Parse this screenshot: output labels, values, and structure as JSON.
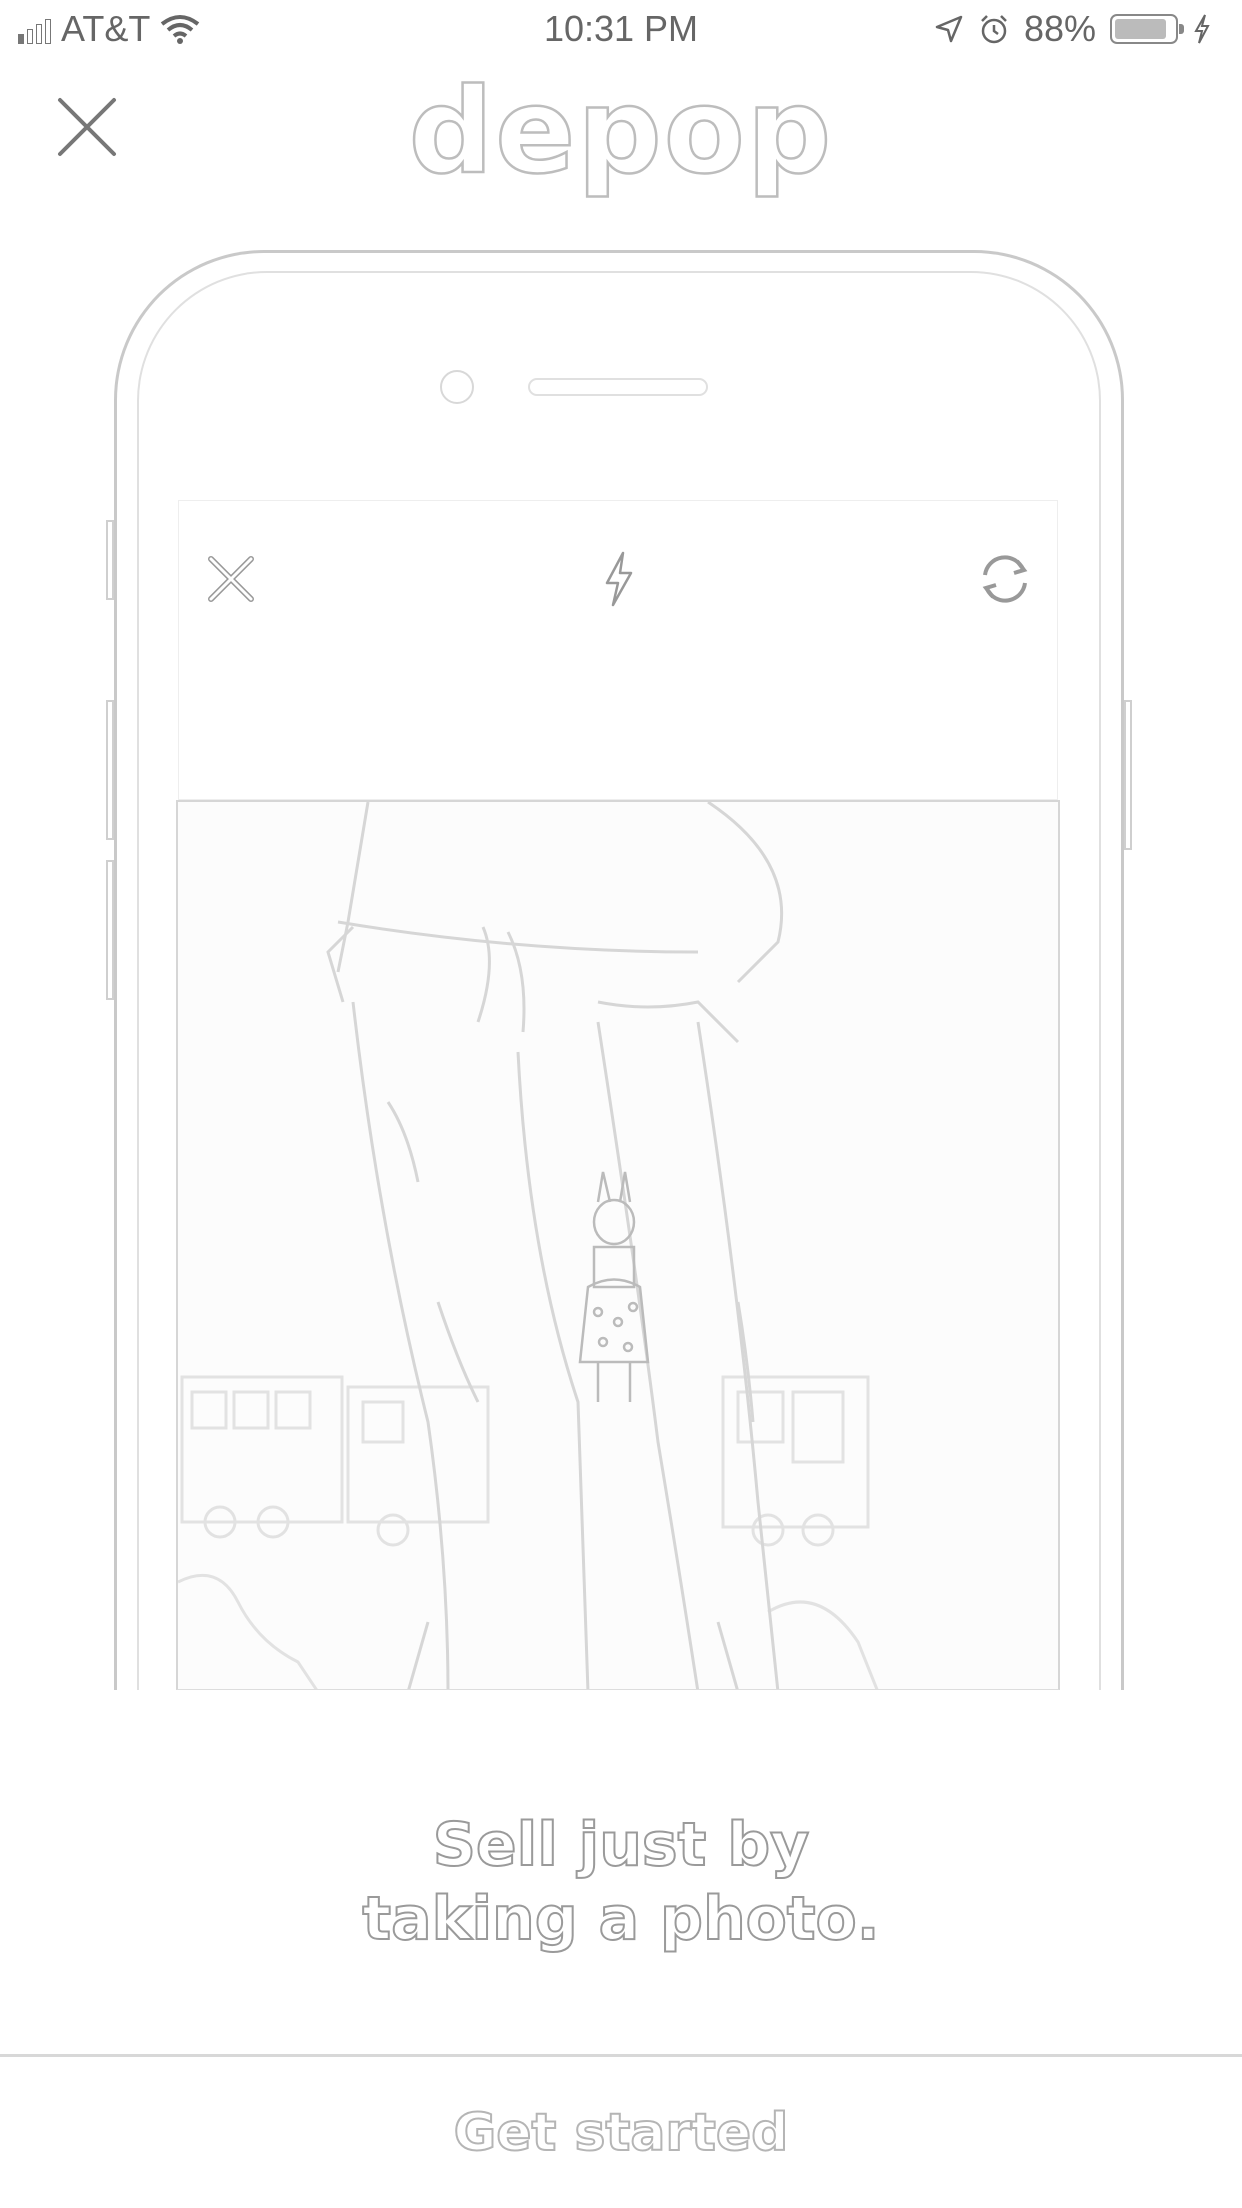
{
  "status_bar": {
    "carrier": "AT&T",
    "time": "10:31 PM",
    "battery_percent": "88%",
    "battery_level": 0.88,
    "signal_bars": 1,
    "icons": [
      "signal-icon",
      "wifi-icon",
      "location-arrow-icon",
      "alarm-icon",
      "battery-icon",
      "charging-icon"
    ]
  },
  "header": {
    "logo": "depop",
    "close_icon": "close-icon"
  },
  "illustration": {
    "toolbar_icons": [
      "close-icon",
      "flash-icon",
      "switch-camera-icon"
    ]
  },
  "tagline": {
    "line1": "Sell just by",
    "line2": "taking a photo."
  },
  "cta": {
    "label": "Get started"
  },
  "colors": {
    "background": "#ffffff",
    "outline": "#bdbdbd",
    "text": "#666666"
  }
}
